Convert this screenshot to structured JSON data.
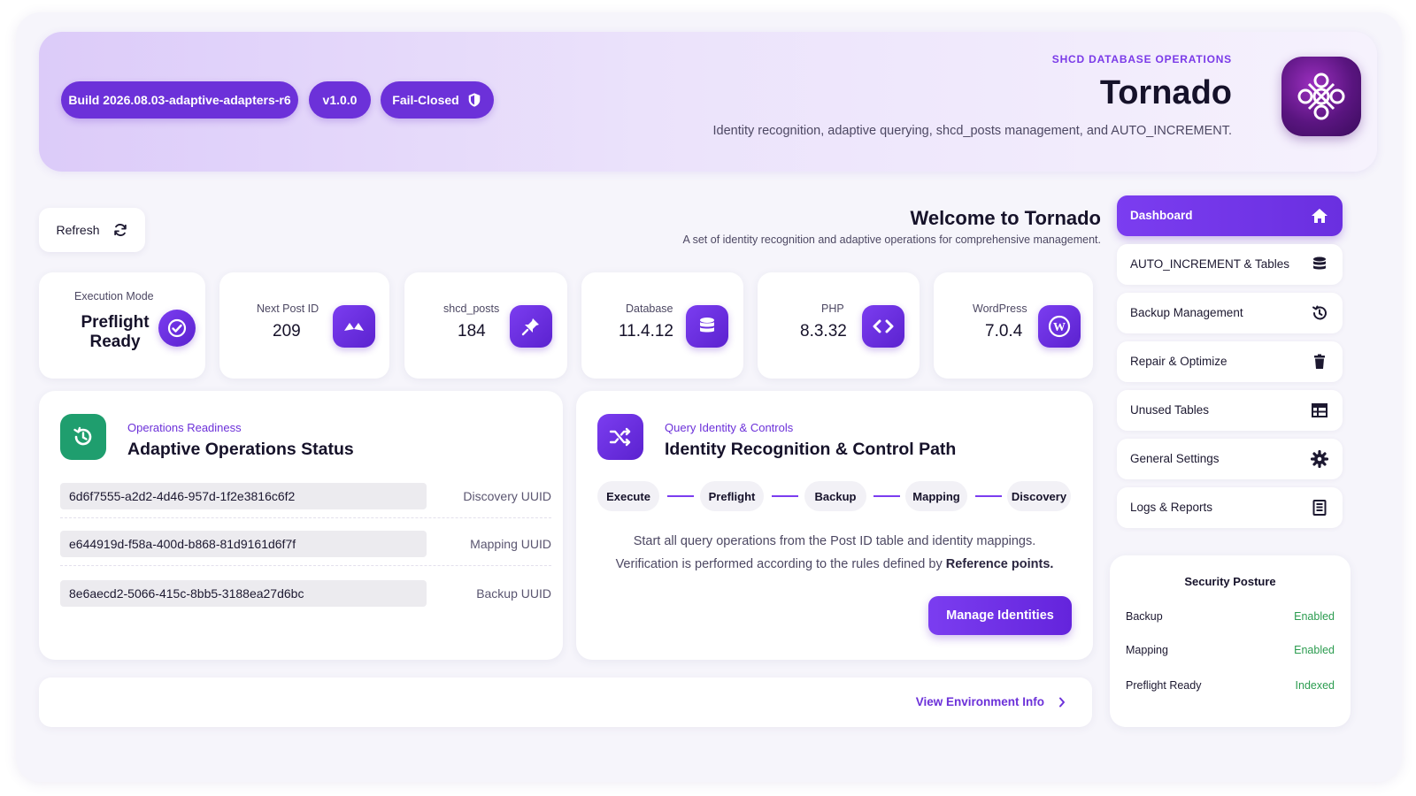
{
  "header": {
    "build": "Build 2026.08.03-adaptive-adapters-r6",
    "version": "v1.0.0",
    "mode": "Fail-Closed",
    "eyebrow": "SHCD DATABASE OPERATIONS",
    "title": "Tornado",
    "subtitle": "Identity recognition, adaptive querying, shcd_posts management, and AUTO_INCREMENT."
  },
  "toolbar": {
    "refresh_label": "Refresh"
  },
  "welcome": {
    "title": "Welcome to Tornado",
    "subtitle": "A set of identity recognition and adaptive operations for comprehensive management."
  },
  "stats": [
    {
      "label": "Execution Mode",
      "value": "Preflight Ready",
      "icon": "check-circle-icon"
    },
    {
      "label": "Next Post ID",
      "value": "209",
      "icon": "arrows-icon"
    },
    {
      "label": "shcd_posts",
      "value": "184",
      "icon": "pin-icon"
    },
    {
      "label": "Database",
      "value": "11.4.12",
      "icon": "database-icon"
    },
    {
      "label": "PHP",
      "value": "8.3.32",
      "icon": "code-icon"
    },
    {
      "label": "WordPress",
      "value": "7.0.4",
      "icon": "wordpress-icon"
    }
  ],
  "status_panel": {
    "eyebrow": "Operations Readiness",
    "title": "Adaptive Operations Status",
    "rows": [
      {
        "uuid": "6d6f7555-a2d2-4d46-957d-1f2e3816c6f2",
        "label": "Discovery UUID"
      },
      {
        "uuid": "e644919d-f58a-400d-b868-81d9161d6f7f",
        "label": "Mapping UUID"
      },
      {
        "uuid": "8e6aecd2-5066-415c-8bb5-3188ea27d6bc",
        "label": "Backup UUID"
      }
    ]
  },
  "identity_panel": {
    "eyebrow": "Query Identity & Controls",
    "title": "Identity Recognition & Control Path",
    "steps": [
      "Execute",
      "Preflight",
      "Backup",
      "Mapping",
      "Discovery"
    ],
    "line1": "Start all query operations from the Post ID table and identity mappings.",
    "line2_prefix": "Verification is performed according to the rules defined by ",
    "line2_bold": "Reference points.",
    "button": "Manage Identities"
  },
  "env_link": "View Environment Info",
  "sidebar": {
    "items": [
      {
        "label": "Dashboard",
        "icon": "home-icon",
        "active": true
      },
      {
        "label": "AUTO_INCREMENT & Tables",
        "icon": "database-icon"
      },
      {
        "label": "Backup Management",
        "icon": "history-icon"
      },
      {
        "label": "Repair & Optimize",
        "icon": "trash-icon"
      },
      {
        "label": "Unused Tables",
        "icon": "table-icon"
      },
      {
        "label": "General Settings",
        "icon": "gear-icon"
      },
      {
        "label": "Logs & Reports",
        "icon": "list-icon"
      }
    ]
  },
  "posture": {
    "title": "Security Posture",
    "rows": [
      {
        "label": "Backup",
        "value": "Enabled"
      },
      {
        "label": "Mapping",
        "value": "Enabled"
      },
      {
        "label": "Preflight Ready",
        "value": "Indexed"
      }
    ]
  },
  "colors": {
    "accent": "#6c31d9",
    "success": "#2c9c50",
    "status_icon": "#1f9e6e"
  }
}
